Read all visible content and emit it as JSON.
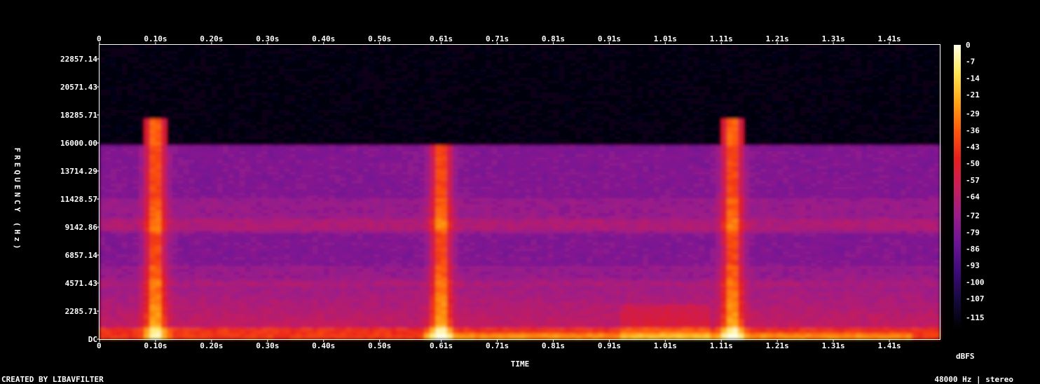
{
  "chart_data": {
    "type": "heatmap",
    "title": "",
    "xlabel": "TIME",
    "ylabel": "FREQUENCY (Hz)",
    "x_ticks": [
      "0",
      "0.10s",
      "0.20s",
      "0.30s",
      "0.40s",
      "0.50s",
      "0.61s",
      "0.71s",
      "0.81s",
      "0.91s",
      "1.01s",
      "1.11s",
      "1.21s",
      "1.31s",
      "1.41s"
    ],
    "x_tick_values_s": [
      0,
      0.1,
      0.2,
      0.3,
      0.4,
      0.5,
      0.61,
      0.71,
      0.81,
      0.91,
      1.01,
      1.11,
      1.21,
      1.31,
      1.41
    ],
    "xlim_s": [
      0,
      1.5
    ],
    "y_ticks": [
      "DC",
      "2285.71",
      "4571.43",
      "6857.14",
      "9142.86",
      "11428.57",
      "13714.29",
      "16000.00",
      "18285.71",
      "20571.43",
      "22857.14"
    ],
    "y_tick_values_hz": [
      0,
      2285.71,
      4571.43,
      6857.14,
      9142.86,
      11428.57,
      13714.29,
      16000.0,
      18285.71,
      20571.43,
      22857.14
    ],
    "ylim_hz": [
      0,
      24000
    ],
    "colorbar": {
      "label": "dBFS",
      "ticks": [
        "0",
        "-7",
        "-14",
        "-21",
        "-29",
        "-36",
        "-43",
        "-50",
        "-57",
        "-64",
        "-72",
        "-79",
        "-86",
        "-93",
        "-100",
        "-107",
        "-115"
      ],
      "range_db": [
        -120,
        0
      ],
      "colors": [
        "#000000",
        "#140a3c",
        "#3d0a78",
        "#6a1496",
        "#9b1c8a",
        "#c81e5a",
        "#e61e1e",
        "#ff5a0a",
        "#ffa514",
        "#ffe650",
        "#ffffe6"
      ]
    },
    "features": {
      "noise_floor_top_hz": 15900,
      "transients_s": [
        0.1,
        0.61,
        1.13
      ],
      "transient_extends_to_hz": [
        17900,
        15900,
        17900
      ],
      "low_band_strong_hz": [
        0,
        1000
      ],
      "harmonic_stack_s": [
        0.93,
        1.04
      ],
      "harmonic_stack_top_hz": 3000
    }
  },
  "footer": {
    "left": "CREATED BY LIBAVFILTER",
    "right": "48000 Hz | stereo"
  }
}
